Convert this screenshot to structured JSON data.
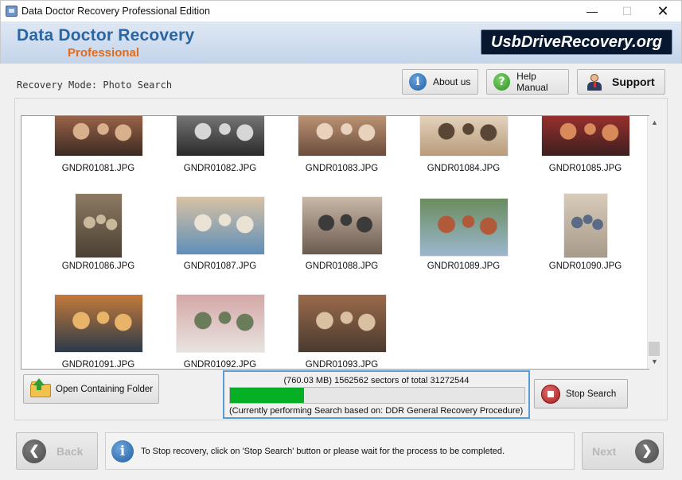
{
  "window": {
    "title": "Data Doctor Recovery Professional Edition",
    "controls": {
      "minimize": "—",
      "maximize": "☐",
      "close": "✕"
    }
  },
  "header": {
    "brand_main": "Data Doctor Recovery",
    "brand_sub": "Professional",
    "site_badge": "UsbDriveRecovery.org"
  },
  "mode": {
    "label": "Recovery Mode: Photo Search"
  },
  "toolbar": {
    "about_label": "About us",
    "about_icon": "i",
    "help_label": "Help Manual",
    "help_icon": "?",
    "support_label": "Support"
  },
  "files": [
    {
      "name": "GNDR01081.JPG",
      "colors": [
        "#3b2a22",
        "#a46a4c",
        "#d9b08c"
      ]
    },
    {
      "name": "GNDR01082.JPG",
      "colors": [
        "#2a2a2a",
        "#7d7d7d",
        "#d6d6d6"
      ]
    },
    {
      "name": "GNDR01083.JPG",
      "colors": [
        "#6b4d3b",
        "#c49a7a",
        "#e8d2bd"
      ]
    },
    {
      "name": "GNDR01084.JPG",
      "colors": [
        "#b99b7a",
        "#e8d9c4",
        "#5a4636"
      ]
    },
    {
      "name": "GNDR01085.JPG",
      "colors": [
        "#3c1f1f",
        "#a3322f",
        "#d98a5b"
      ]
    },
    {
      "name": "GNDR01086.JPG",
      "colors": [
        "#4a4033",
        "#8d7a62",
        "#c9b89b"
      ]
    },
    {
      "name": "GNDR01087.JPG",
      "colors": [
        "#5f8fb8",
        "#d7c1a4",
        "#e9e2d5"
      ]
    },
    {
      "name": "GNDR01088.JPG",
      "colors": [
        "#6b5a4e",
        "#c8b8a8",
        "#3b3b3b"
      ]
    },
    {
      "name": "GNDR01089.JPG",
      "colors": [
        "#9cb7cf",
        "#6a8c5e",
        "#b05a3a"
      ]
    },
    {
      "name": "GNDR01090.JPG",
      "colors": [
        "#a89a8a",
        "#d8cbb9",
        "#5b6b86"
      ]
    },
    {
      "name": "GNDR01091.JPG",
      "colors": [
        "#2b3a4a",
        "#c47a3a",
        "#e7b46a"
      ]
    },
    {
      "name": "GNDR01092.JPG",
      "colors": [
        "#e8e4e0",
        "#d4a7a7",
        "#6a7c5a"
      ]
    },
    {
      "name": "GNDR01093.JPG",
      "colors": [
        "#4a3a30",
        "#9a6a4a",
        "#d8c0a0"
      ]
    }
  ],
  "actions": {
    "open_folder_label": "Open Containing Folder",
    "stop_label": "Stop Search"
  },
  "progress": {
    "line1": "(760.03 MB) 1562562  sectors  of  total 31272544",
    "line2": "(Currently performing Search based on:  DDR General Recovery Procedure)",
    "fraction": 0.25,
    "color": "#06b025"
  },
  "footer": {
    "back_label": "Back",
    "next_label": "Next",
    "info_icon": "i",
    "info_text": "To Stop recovery, click on 'Stop Search' button or please wait for the process to be completed."
  }
}
